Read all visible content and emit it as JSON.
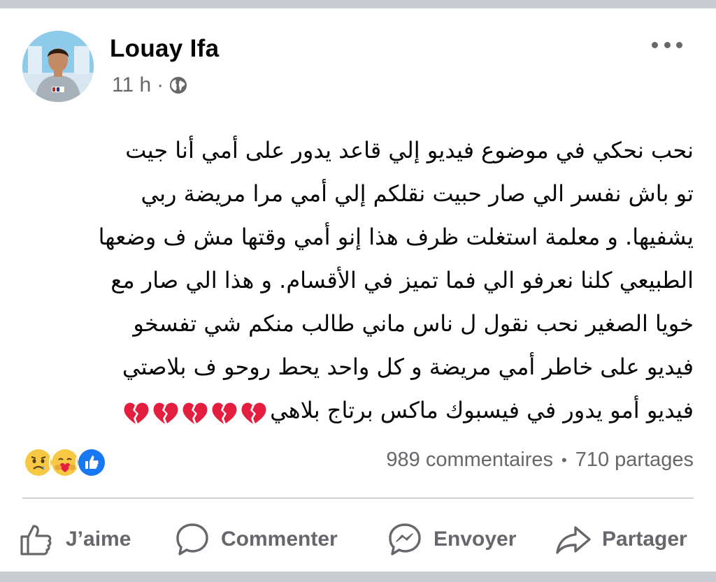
{
  "post": {
    "author": "Louay Ifa",
    "time": "11 h",
    "separator": "·",
    "audience_icon": "globe-icon",
    "text_lines": [
      "نحب نحكي في موضوع فيديو إلي قاعد يدور على أمي  أنا جيت",
      "تو باش نفسر الي صار حبيت نقلكم إلي أمي  مرا مريضة ربي",
      "يشفيها. و معلمة استغلت ظرف هذا إنو أمي وقتها مش ف وضعها",
      "الطبيعي  كلنا نعرفو الي فما تميز في الأقسام.  و هذا الي صار مع",
      "خويا الصغير  نحب نقول ل ناس ماني طالب منكم شي تفسخو",
      "فيديو على خاطر أمي مريضة و كل واحد يحط روحو ف بلاصتي",
      "فيديو أمو يدور في فيسبوك ماكس برتاج بلاهي"
    ],
    "broken_heart_count": 5
  },
  "stats": {
    "reaction_icons": [
      "sad-reaction-icon",
      "care-reaction-icon",
      "like-reaction-icon"
    ],
    "comments": "989 commentaires",
    "bullet": "•",
    "shares": "710 partages"
  },
  "actions": {
    "like": "J’aime",
    "comment": "Commenter",
    "send": "Envoyer",
    "share": "Partager"
  },
  "colors": {
    "text": "#050505",
    "secondary": "#65676b",
    "like_blue": "#1877f2",
    "heart_red": "#e41e3f",
    "divider": "#ced0d4",
    "page_bg": "#c9ccd1"
  }
}
